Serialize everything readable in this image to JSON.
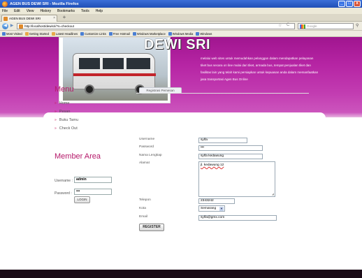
{
  "window": {
    "title": "AGEN BUS DEWI SRI - Mozilla Firefox",
    "controls": [
      "_",
      "□",
      "x"
    ]
  },
  "menubar": [
    "File",
    "Edit",
    "View",
    "History",
    "Bookmarks",
    "Tools",
    "Help"
  ],
  "tabs": [
    {
      "label": "AGEN BUS DEWI SRI"
    }
  ],
  "newtab_label": "+",
  "nav": {
    "back": "◀",
    "forward": "▶",
    "url": "http://localhost/dewisri/?s=checkout",
    "star": "☆",
    "reload": "C",
    "search_placeholder": "Google",
    "search_go": "⚲"
  },
  "bookmarks": [
    {
      "label": "Most Visited",
      "icon": "blue"
    },
    {
      "label": "Getting Started",
      "icon": "orange"
    },
    {
      "label": "Latest Headlines",
      "icon": "orange"
    },
    {
      "label": "Customize Links",
      "icon": "blue"
    },
    {
      "label": "Free Hotmail",
      "icon": "blue"
    },
    {
      "label": "Windows Marketplace",
      "icon": "blue"
    },
    {
      "label": "Windows Media",
      "icon": "blue"
    },
    {
      "label": "Windows",
      "icon": "blue"
    }
  ],
  "header": {
    "brand": "DEWI SRI",
    "intro": "melalui web sites untuk memudahkan pelanggan dalam mendapatkan pelayanan tiket bus secara on line mulai dari tiket, armada bus, tempat penjualan tiket dan fasilitas lain yang telah kami persiapkan untuk kepuasan anda dalam memanfaatkan jasa transportasi Agen Bus Online"
  },
  "menu": {
    "title": "Menu",
    "items": [
      "Home",
      "Pesan",
      "Buku Tamu",
      "Check Out"
    ]
  },
  "member": {
    "title": "Member Area",
    "username_label": "Username :",
    "username_value": "admin",
    "password_label": "Password :",
    "password_value": "•••",
    "login_label": "LOGIN"
  },
  "form": {
    "tab_label": "Registrasi Pemesan",
    "fields": {
      "username": {
        "label": "Username",
        "value": "sylfa"
      },
      "password": {
        "label": "Password",
        "value": "•••"
      },
      "nama": {
        "label": "Nama Lengkap",
        "value": "sylfa kedawung"
      },
      "alamat": {
        "label": "Alamat",
        "value": "jl. kedawung 12"
      },
      "telepon": {
        "label": "Telepon",
        "value": "2343242"
      },
      "kota": {
        "label": "Kota",
        "value": "Semarang"
      },
      "email": {
        "label": "Email",
        "value": "sylfa@gmx.com"
      }
    },
    "submit_label": "REGISTER"
  }
}
